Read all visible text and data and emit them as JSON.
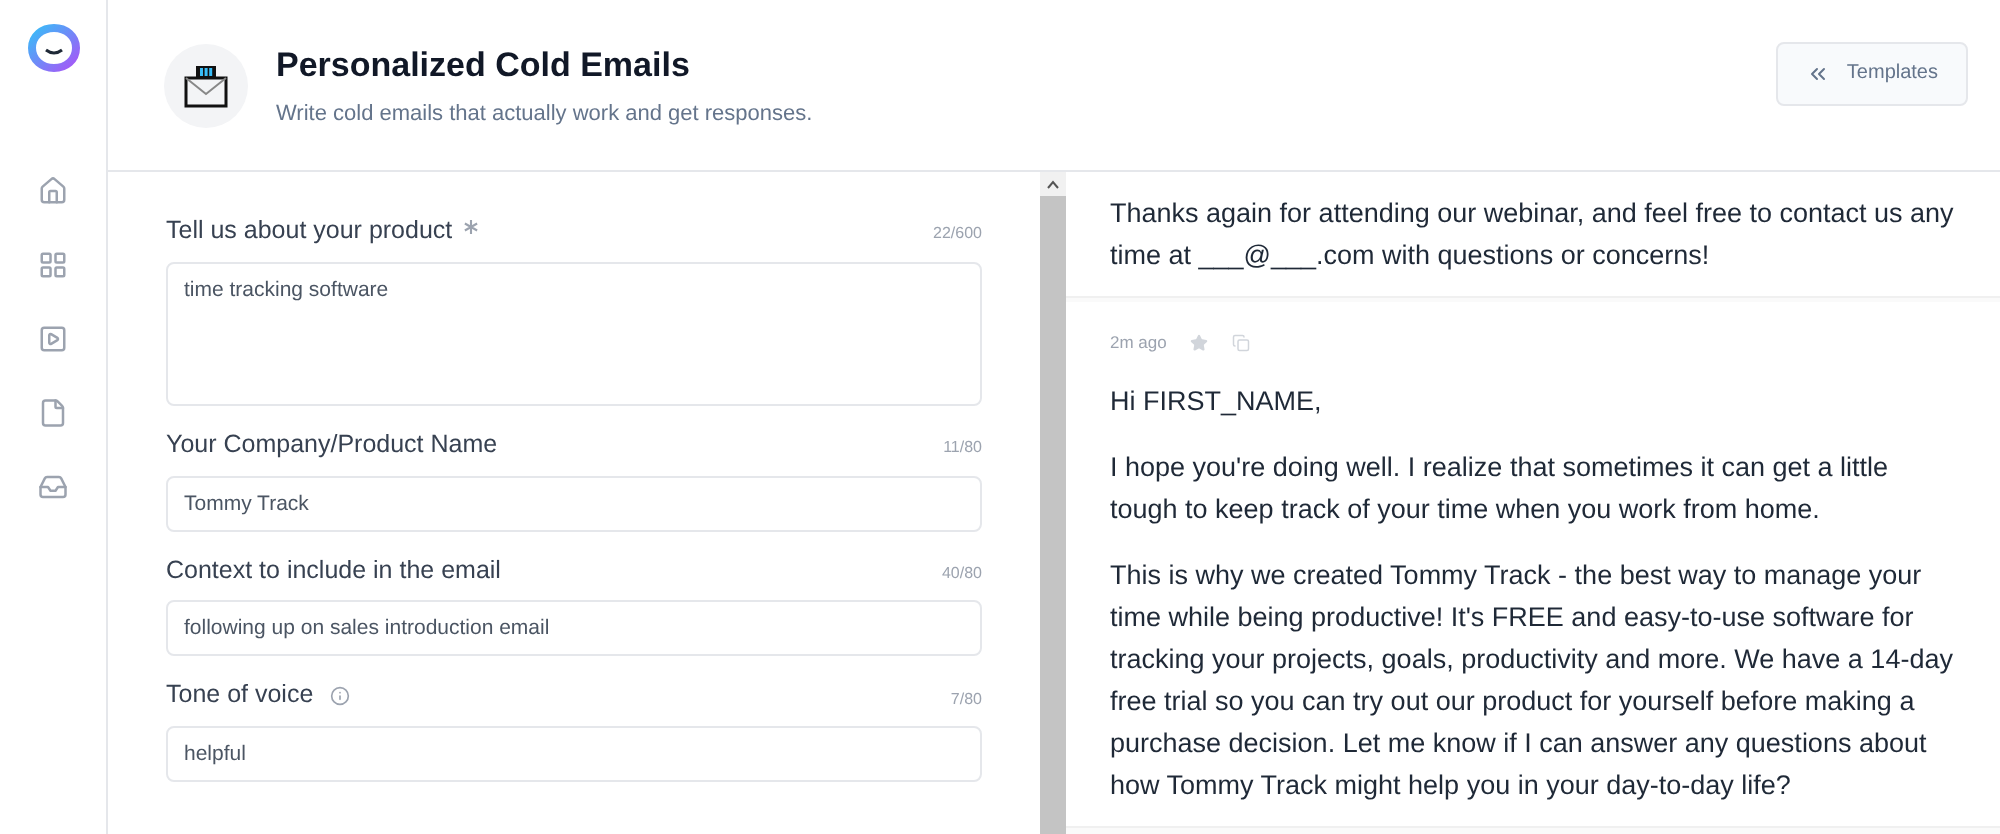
{
  "header": {
    "title": "Personalized Cold Emails",
    "subtitle": "Write cold emails that actually work and get responses.",
    "templates_button": "Templates"
  },
  "form": {
    "fields": [
      {
        "label": "Tell us about your product",
        "required": true,
        "info": false,
        "counter": "22/600",
        "value": "time tracking software",
        "kind": "textarea"
      },
      {
        "label": "Your Company/Product Name",
        "required": false,
        "info": false,
        "counter": "11/80",
        "value": "Tommy Track",
        "kind": "input"
      },
      {
        "label": "Context to include in the email",
        "required": false,
        "info": false,
        "counter": "40/80",
        "value": "following up on sales introduction email",
        "kind": "input"
      },
      {
        "label": "Tone of voice",
        "required": false,
        "info": true,
        "counter": "7/80",
        "value": "helpful",
        "kind": "input"
      }
    ]
  },
  "results": [
    {
      "paragraphs": [
        "Thanks again for attending our webinar, and feel free to contact us any time at ___@___.com with questions or concerns!"
      ]
    },
    {
      "time": "2m ago",
      "starred": false,
      "paragraphs": [
        "Hi FIRST_NAME,",
        "I hope you're doing well. I realize that sometimes it can get a little tough to keep track of your time when you work from home.",
        "This is why we created Tommy Track - the best way to manage your time while being productive! It's FREE and easy-to-use software for tracking your projects, goals, productivity and more. We have a 14-day free trial so you can try out our product for yourself before making a purchase decision. Let me know if I can answer any questions about how Tommy Track might help you in your day-to-day life?"
      ]
    }
  ]
}
